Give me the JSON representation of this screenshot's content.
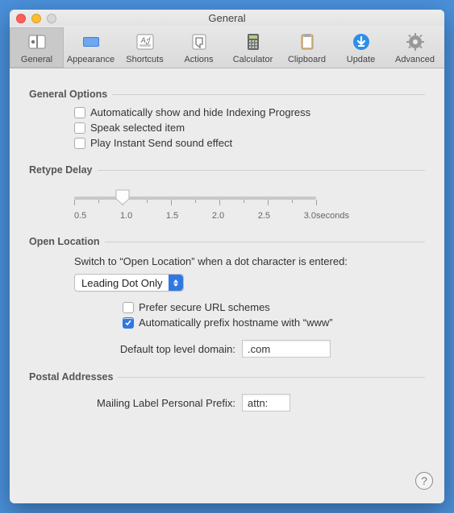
{
  "window": {
    "title": "General"
  },
  "toolbar": {
    "items": [
      {
        "label": "General"
      },
      {
        "label": "Appearance"
      },
      {
        "label": "Shortcuts"
      },
      {
        "label": "Actions"
      },
      {
        "label": "Calculator"
      },
      {
        "label": "Clipboard"
      },
      {
        "label": "Update"
      },
      {
        "label": "Advanced"
      }
    ]
  },
  "sections": {
    "general_options": {
      "title": "General Options",
      "items": [
        "Automatically show and hide Indexing Progress",
        "Speak selected item",
        "Play Instant Send sound effect"
      ]
    },
    "retype_delay": {
      "title": "Retype Delay",
      "labels": [
        "0.5",
        "1.0",
        "1.5",
        "2.0",
        "2.5",
        "3.0"
      ],
      "unit": "seconds",
      "value": 1.0,
      "min": 0.5,
      "max": 3.0
    },
    "open_location": {
      "title": "Open Location",
      "hint": "Switch to “Open Location” when a dot character is entered:",
      "select_value": "Leading Dot Only",
      "prefer_secure": "Prefer secure URL schemes",
      "auto_www": "Automatically prefix hostname with “www”",
      "tld_label": "Default top level domain:",
      "tld_value": ".com"
    },
    "postal": {
      "title": "Postal Addresses",
      "prefix_label": "Mailing Label Personal Prefix:",
      "prefix_value": "attn:"
    }
  }
}
